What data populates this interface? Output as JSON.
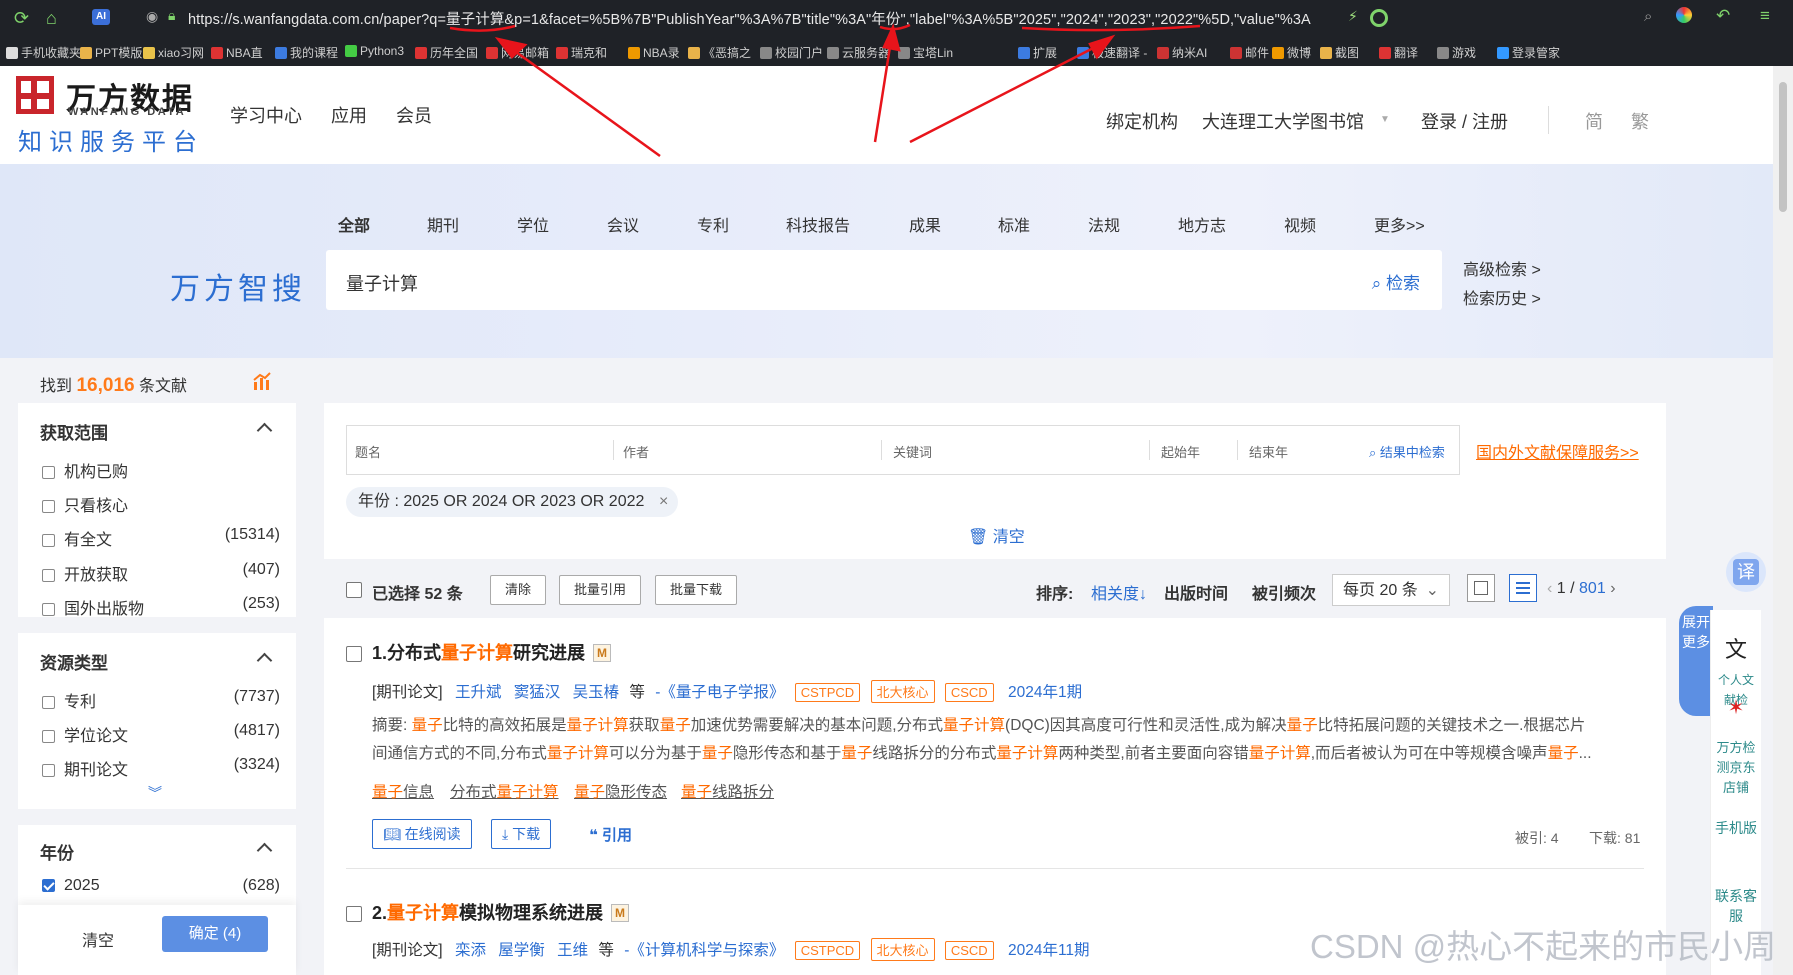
{
  "browser": {
    "url": "https://s.wanfangdata.com.cn/paper?q=量子计算&p=1&facet=%5B%7B\"PublishYear\"%3A%7B\"title\"%3A\"年份\",\"label\"%3A%5B\"2025\",\"2024\",\"2023\",\"2022\"%5D,\"value\"%3A",
    "bookmarks": [
      "手机收藏夹",
      "PPT模版",
      "xiao习网",
      "NBA直",
      "我的课程",
      "Python3",
      "历年全国",
      "网易邮箱",
      "瑞克和",
      "NBA录",
      "《恶搞之",
      "校园门户",
      "云服务器",
      "宝塔Lin",
      "扩展",
      "极速翻译 -",
      "纳米AI",
      "邮件",
      "微博",
      "截图",
      "翻译",
      "游戏",
      "登录管家"
    ],
    "ai_badge": "AI"
  },
  "header": {
    "logo_cn": "万方数据",
    "logo_en": "WANFANG DATA",
    "logo_sub": "知识服务平台",
    "nav": [
      "学习中心",
      "应用",
      "会员"
    ],
    "bind": "绑定机构",
    "library": "大连理工大学图书馆",
    "login": "登录 / 注册",
    "lang_simple": "简",
    "lang_trad": "繁"
  },
  "search": {
    "brand": "万方智搜",
    "tabs": [
      "全部",
      "期刊",
      "学位",
      "会议",
      "专利",
      "科技报告",
      "成果",
      "标准",
      "法规",
      "地方志",
      "视频",
      "更多>>"
    ],
    "query": "量子计算",
    "button": "检索",
    "advanced": "高级检索 >",
    "history": "检索历史 >"
  },
  "results": {
    "found_prefix": "找到",
    "found_count": "16,016",
    "found_suffix": "条文献"
  },
  "sidebar": {
    "scope_title": "获取范围",
    "scope": [
      {
        "label": "机构已购",
        "count": ""
      },
      {
        "label": "只看核心",
        "count": ""
      },
      {
        "label": "有全文",
        "count": "(15314)"
      },
      {
        "label": "开放获取",
        "count": "(407)"
      },
      {
        "label": "国外出版物",
        "count": "(253)"
      }
    ],
    "type_title": "资源类型",
    "types": [
      {
        "label": "专利",
        "count": "(7737)"
      },
      {
        "label": "学位论文",
        "count": "(4817)"
      },
      {
        "label": "期刊论文",
        "count": "(3324)"
      }
    ],
    "year_title": "年份",
    "years": [
      {
        "label": "2025",
        "count": "(628)",
        "checked": true
      }
    ],
    "clear": "清空",
    "confirm": "确定 (4)"
  },
  "filters": {
    "fields": [
      "题名",
      "作者",
      "关键词",
      "起始年",
      "结束年"
    ],
    "search_in": "结果中检索",
    "guarantee": "国内外文献保障服务>>",
    "chip": "年份 : 2025 OR 2024 OR 2023 OR 2022",
    "clear": "清空"
  },
  "toolbar": {
    "selected": "已选择 52 条",
    "clear": "清除",
    "batch_cite": "批量引用",
    "batch_download": "批量下载",
    "sort_label": "排序:",
    "sort_relevance": "相关度↓",
    "sort_date": "出版时间",
    "sort_cited": "被引频次",
    "per_page": "每页 20 条",
    "page_current": "1",
    "page_total": "801"
  },
  "cards": [
    {
      "num": "1.",
      "title_pre": "分布式",
      "title_hl": "量子计算",
      "title_post": "研究进展",
      "type": "[期刊论文]",
      "authors": [
        "王升斌",
        "窦猛汉",
        "吴玉椿"
      ],
      "etc": "等",
      "journal": "-《量子电子学报》",
      "tags": [
        "CSTPCD",
        "北大核心",
        "CSCD"
      ],
      "issue": "2024年1期",
      "abstract_1": "摘要: 量子比特的高效拓展是量子计算获取量子加速优势需要解决的基本问题,分布式量子计算(DQC)因其高度可行性和灵活性,成为解决量子比特拓展问题的关键技术之一.根据芯片",
      "abstract_2": "间通信方式的不同,分布式量子计算可以分为基于量子隐形传态和基于量子线路拆分的分布式量子计算两种类型,前者主要面向容错量子计算,而后者被认为可在中等规模含噪声量子...",
      "keywords": [
        "量子信息",
        "分布式量子计算",
        "量子隐形传态",
        "量子线路拆分"
      ],
      "read": "在线阅读",
      "download": "下载",
      "cite": "引用",
      "cited": "被引: 4",
      "downloads": "下载: 81"
    },
    {
      "num": "2.",
      "title_pre": "",
      "title_hl": "量子计算",
      "title_post": "模拟物理系统进展",
      "type": "[期刊论文]",
      "authors": [
        "栾添",
        "屋学衡",
        "王维"
      ],
      "etc": "等",
      "journal": "-《计算机科学与探索》",
      "tags": [
        "CSTPCD",
        "北大核心",
        "CSCD"
      ],
      "issue": "2024年11期"
    }
  ],
  "float": {
    "expand": "展开更多",
    "personal": "个人文献检",
    "wf_check": "万方检测京东店铺",
    "mobile": "手机版",
    "contact": "联系客服"
  },
  "watermark": "CSDN @热心不起来的市民小周",
  "colors": {
    "accent": "#2c6ed1",
    "highlight": "#ff6a00",
    "logo_red": "#c9252b",
    "annotation": "#e8141b"
  }
}
